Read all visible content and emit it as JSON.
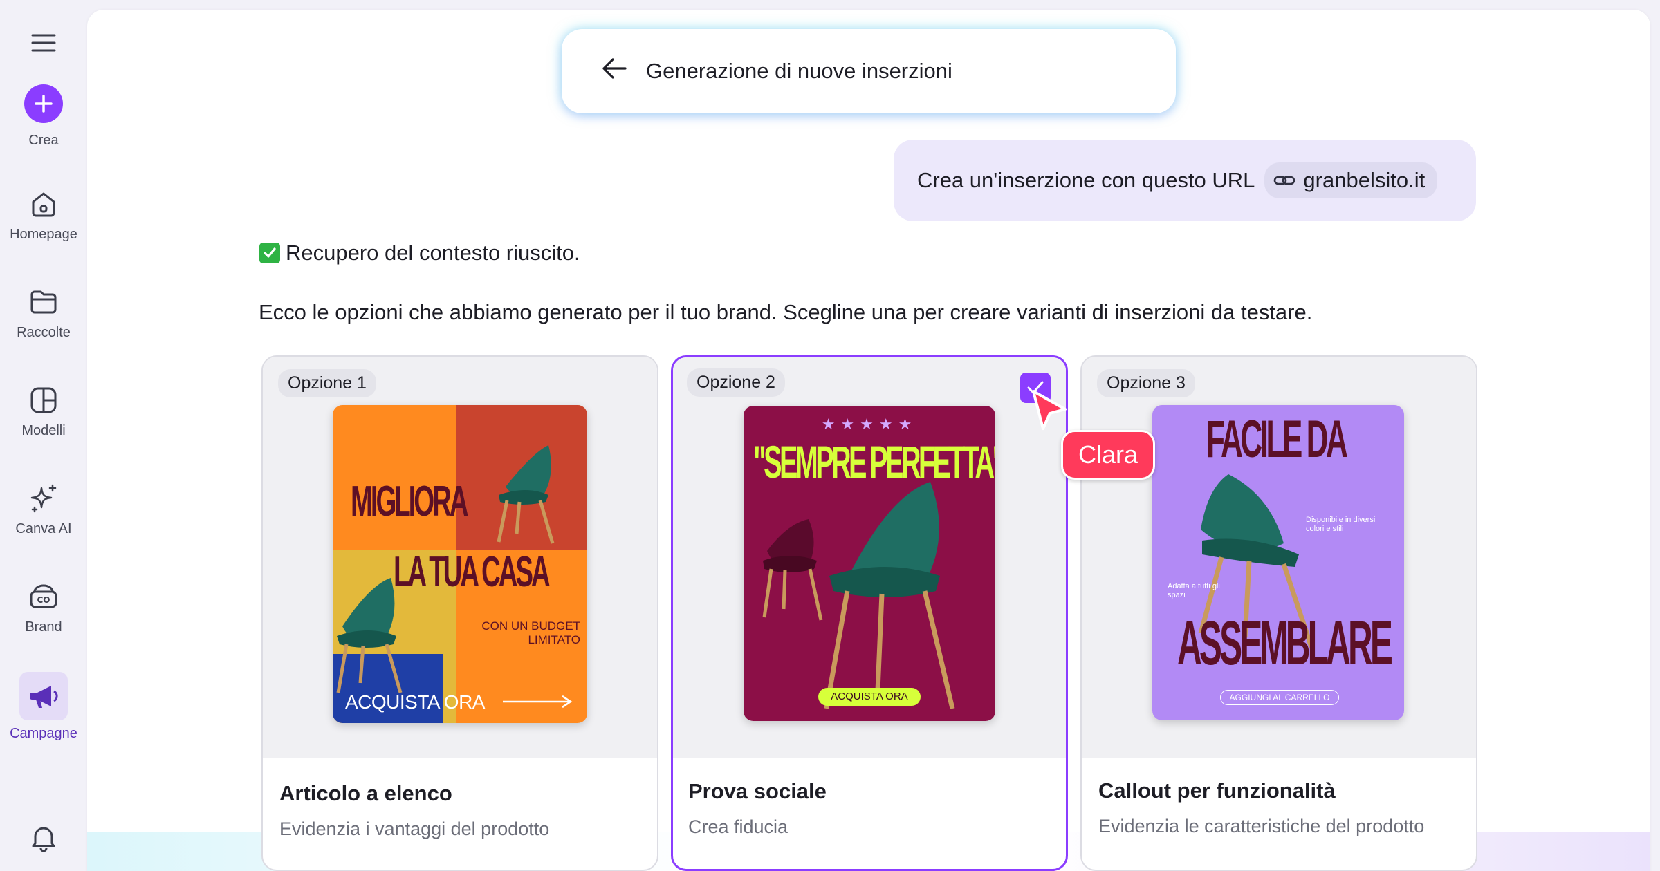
{
  "sidebar": {
    "create_label": "Crea",
    "items": [
      {
        "label": "Homepage",
        "icon": "home-icon"
      },
      {
        "label": "Raccolte",
        "icon": "folder-icon"
      },
      {
        "label": "Modelli",
        "icon": "templates-icon"
      },
      {
        "label": "Canva AI",
        "icon": "sparkles-icon"
      },
      {
        "label": "Brand",
        "icon": "brand-icon"
      },
      {
        "label": "Campagne",
        "icon": "megaphone-icon",
        "active": true
      }
    ]
  },
  "header": {
    "title": "Generazione di nuove inserzioni"
  },
  "chat": {
    "user_message": "Crea un'inserzione con questo URL",
    "url_chip": "granbelsito.it",
    "status": "Recupero del contesto riuscito.",
    "intro": "Ecco le opzioni che abbiamo generato per il tuo brand. Scegline una per creare varianti di inserzioni da testare."
  },
  "options": [
    {
      "tag": "Opzione 1",
      "title": "Articolo a elenco",
      "subtitle": "Evidenzia i vantaggi del prodotto",
      "ad": {
        "line1": "MIGLIORA",
        "line2": "LA TUA CASA",
        "small": "CON UN BUDGET LIMITATO",
        "cta": "ACQUISTA ORA"
      }
    },
    {
      "tag": "Opzione 2",
      "title": "Prova sociale",
      "subtitle": "Crea fiducia",
      "selected": true,
      "ad": {
        "stars": "★★★★★",
        "quote": "\"SEMPRE PERFETTA\"",
        "cta": "ACQUISTA ORA"
      }
    },
    {
      "tag": "Opzione 3",
      "title": "Callout per funzionalità",
      "subtitle": "Evidenzia le caratteristiche del prodotto",
      "ad": {
        "line1": "FACILE DA",
        "line2": "ASSEMBLARE",
        "note1": "Disponibile in diversi colori e stili",
        "note2": "Adatta a tutti gli spazi",
        "cta": "AGGIUNGI AL CARRELLO"
      }
    }
  ],
  "collaborator": {
    "name": "Clara",
    "color": "#ff3a5b"
  },
  "colors": {
    "accent": "#8b3dff",
    "chair": "#1f6e63"
  }
}
